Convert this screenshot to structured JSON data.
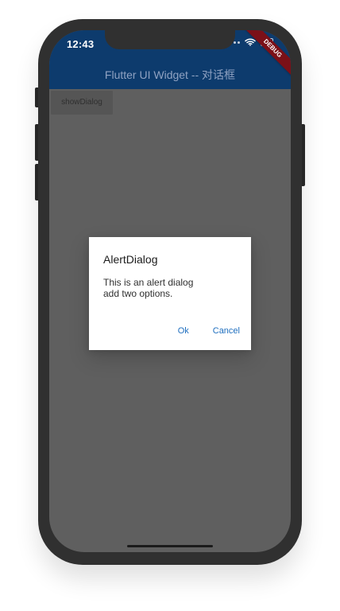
{
  "status_bar": {
    "time": "12:43",
    "wifi_icon": "wifi-icon",
    "battery_icon": "battery-icon"
  },
  "debug_ribbon": {
    "label": "DEBUG"
  },
  "app_bar": {
    "title": "Flutter UI Widget -- 对话框"
  },
  "main": {
    "show_dialog_label": "showDialog"
  },
  "dialog": {
    "title": "AlertDialog",
    "body_lines": [
      "This is an alert dialog",
      "add two options."
    ],
    "actions": [
      {
        "label": "Ok"
      },
      {
        "label": "Cancel"
      }
    ]
  },
  "colors": {
    "app_bar_bg": "#0d3b6d",
    "screen_dim_bg": "#5f5f5f",
    "dialog_bg": "#ffffff",
    "action_text": "#1f6fbf",
    "debug_bg": "#7b1018"
  }
}
